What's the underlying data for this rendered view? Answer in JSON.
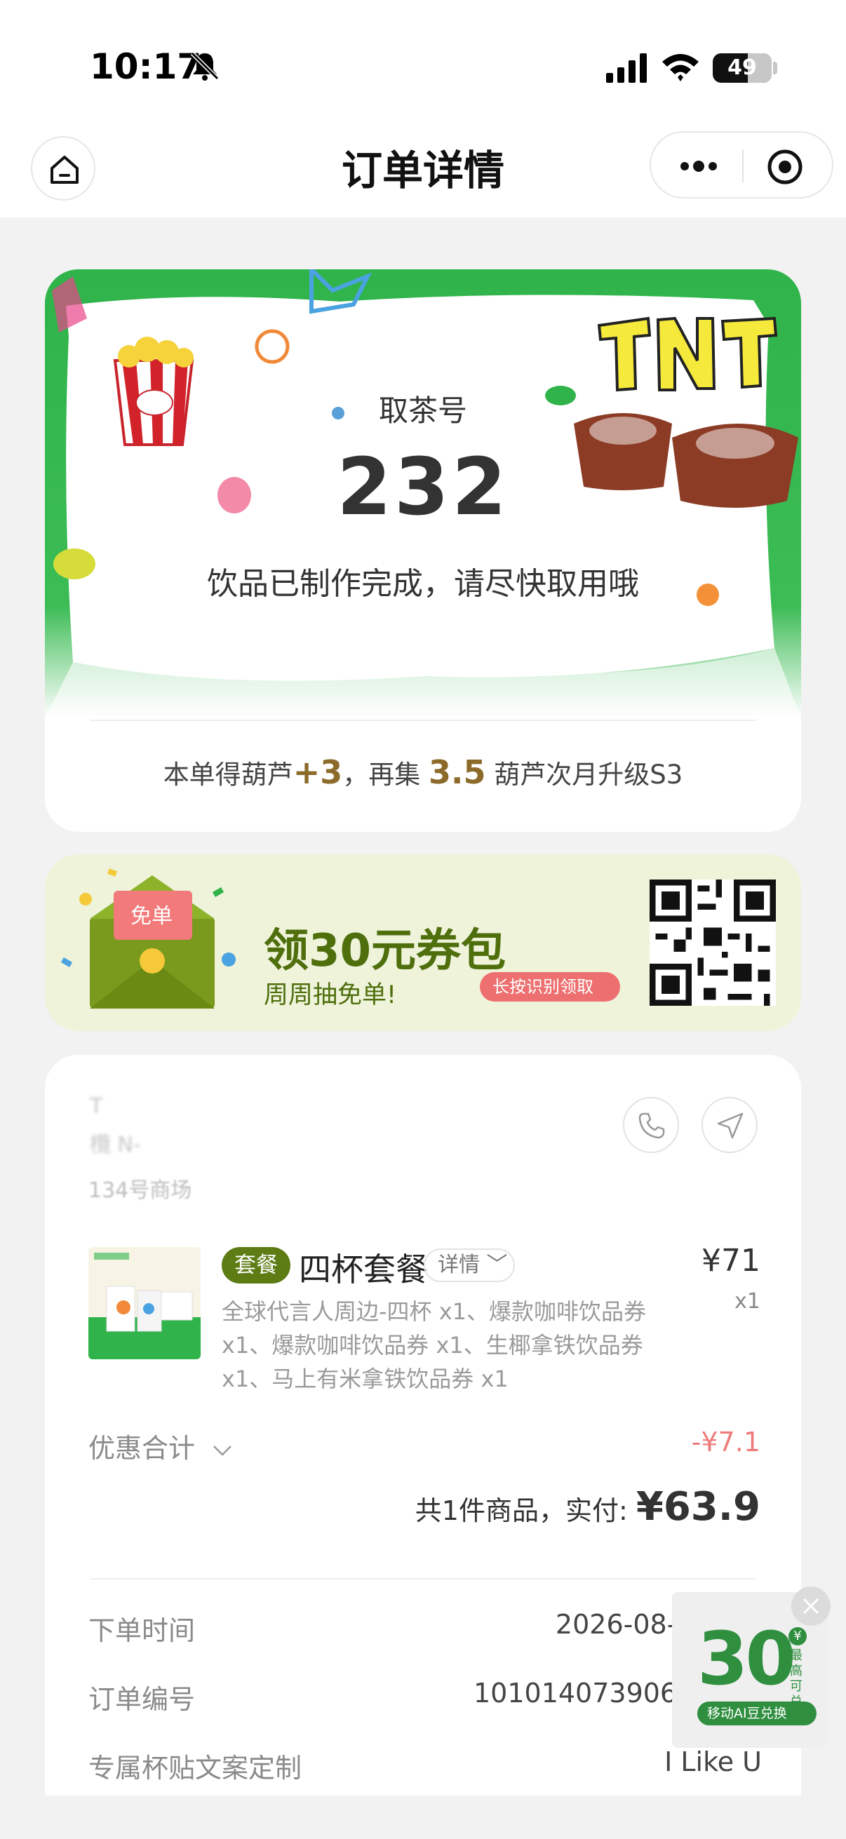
{
  "status_bar": {
    "time": "10:17",
    "battery": "49"
  },
  "nav": {
    "title": "订单详情"
  },
  "pickup": {
    "label": "取茶号",
    "number": "232",
    "status": "饮品已制作完成，请尽快取用哦",
    "points_prefix": "本单得葫芦",
    "points_gain": "+3",
    "points_mid": "，再集",
    "points_need": "3.5",
    "points_suffix": "葫芦次月升级S3"
  },
  "coupon": {
    "title": "领30元券包",
    "subtitle": "周周抽免单!",
    "pill": "长按识别领取",
    "envelope_label": "免单"
  },
  "order": {
    "store_addr": "134号商场",
    "product": {
      "tag": "套餐",
      "name": "四杯套餐",
      "detail": "详情",
      "price": "¥71",
      "qty": "x1",
      "desc": "全球代言人周边-四杯 x1、爆款咖啡饮品券 x1、爆款咖啡饮品券 x1、生椰拿铁饮品券 x1、马上有米拿铁饮品券 x1"
    },
    "discount_label": "优惠合计",
    "discount_value": "-¥7.1",
    "total_prefix": "共1件商品，实付: ",
    "total_amount": "¥63.9",
    "info": [
      {
        "key": "下单时间",
        "value": "2026-08-29 10:"
      },
      {
        "key": "订单编号",
        "value": "10101407390650188"
      },
      {
        "key": "专属杯贴文案定制",
        "value": "I Like U"
      }
    ]
  },
  "float_ad": {
    "number": "30",
    "yen": "¥",
    "caption": "最高可兑",
    "pill": "移动AI豆兑换"
  },
  "colors": {
    "brand_green": "#2fb34a",
    "olive": "#5d7c14",
    "discount_red": "#ee7b7b",
    "points_gold": "#8b6a2a"
  }
}
